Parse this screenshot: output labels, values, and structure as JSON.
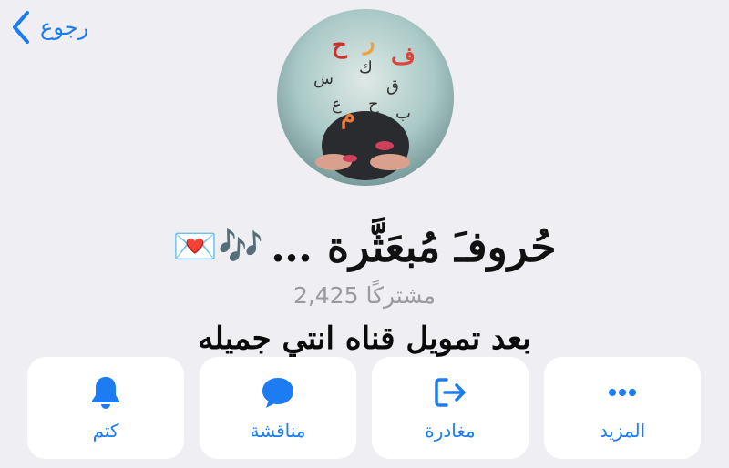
{
  "nav": {
    "back_label": "رجوع"
  },
  "channel": {
    "name": "حُروفـَ مُبعَثَّرة …",
    "emoji": "💌🎶",
    "subscribers": "2,425 مشتركًا",
    "overlay_caption": "بعد تمويل قناه انتي جميله"
  },
  "actions": [
    {
      "label": "المزيد",
      "icon": "more-icon"
    },
    {
      "label": "مغادرة",
      "icon": "leave-icon"
    },
    {
      "label": "مناقشة",
      "icon": "chat-bubble-icon"
    },
    {
      "label": "كتم",
      "icon": "bell-icon"
    }
  ],
  "colors": {
    "accent": "#1e7cf2",
    "background": "#eeeef3",
    "card": "#ffffff",
    "muted": "#9a9aa0"
  }
}
